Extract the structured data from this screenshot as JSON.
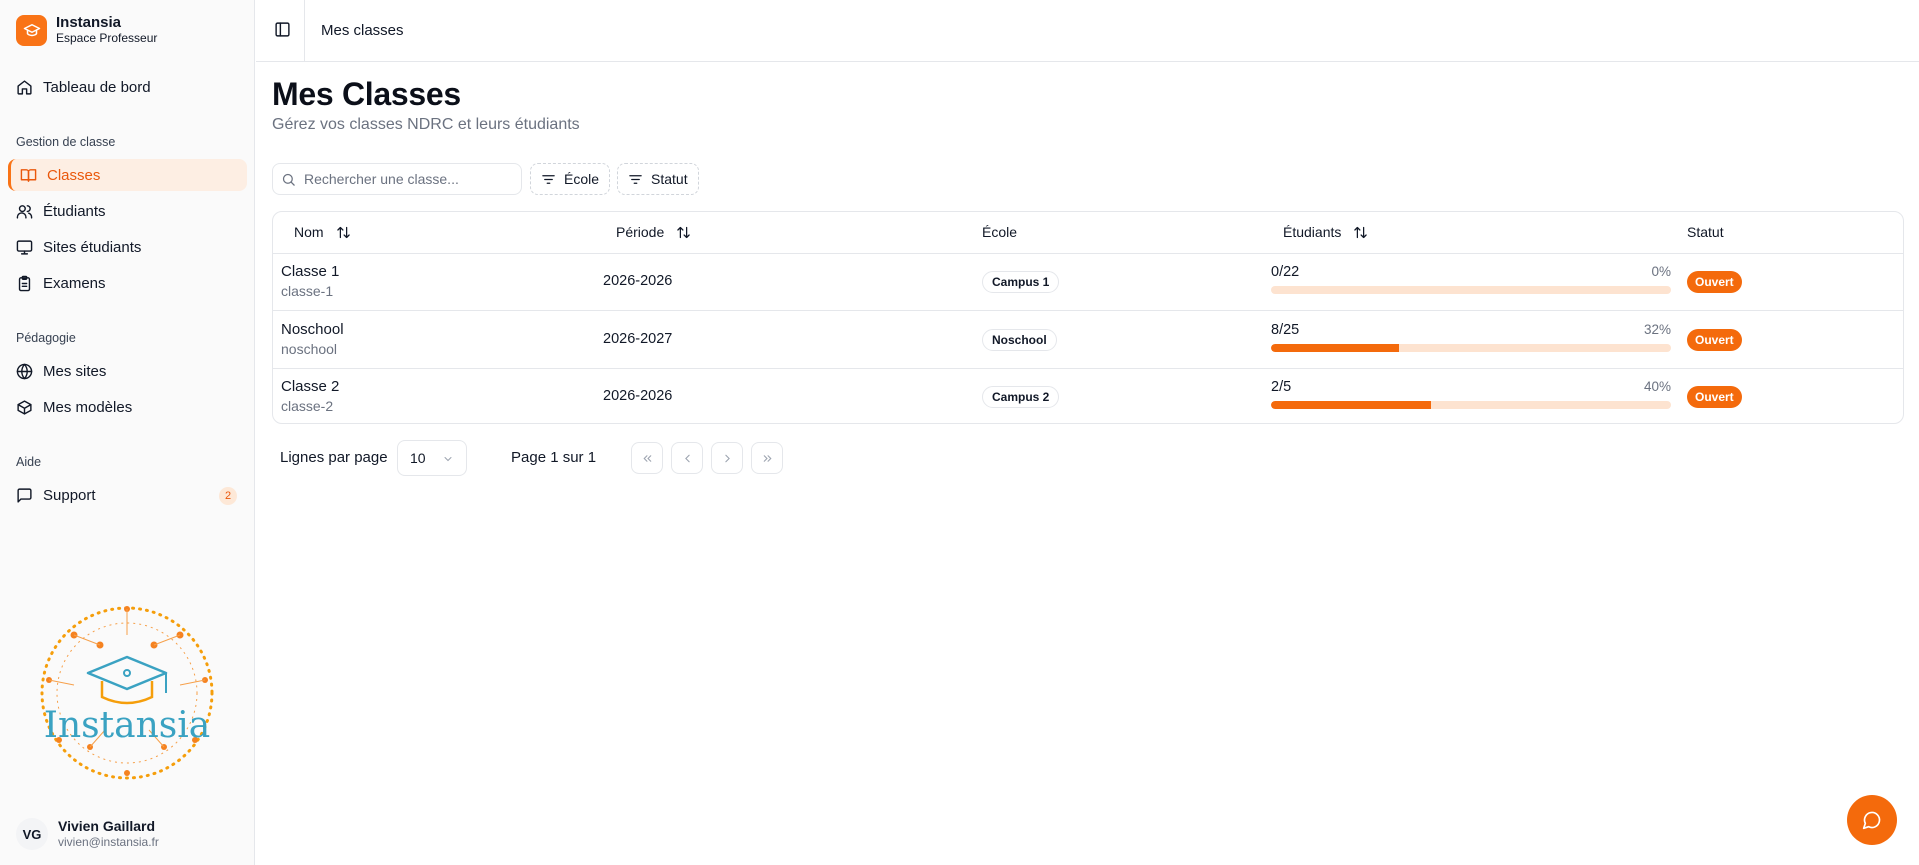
{
  "brand": {
    "name": "Instansia",
    "subtitle": "Espace Professeur"
  },
  "sidebar": {
    "dashboard": "Tableau de bord",
    "sections": {
      "class_mgmt": "Gestion de classe",
      "pedagogy": "Pédagogie",
      "help": "Aide"
    },
    "items": {
      "classes": "Classes",
      "students": "Étudiants",
      "student_sites": "Sites étudiants",
      "exams": "Examens",
      "my_sites": "Mes sites",
      "my_templates": "Mes modèles",
      "support": "Support",
      "support_count": "2"
    },
    "logo_text": "Instansia"
  },
  "user": {
    "initials": "VG",
    "name": "Vivien Gaillard",
    "email": "vivien@instansia.fr"
  },
  "topbar": {
    "title": "Mes classes"
  },
  "page": {
    "title": "Mes Classes",
    "subtitle": "Gérez vos classes NDRC et leurs étudiants"
  },
  "filters": {
    "search_placeholder": "Rechercher une classe...",
    "school": "École",
    "status": "Statut"
  },
  "table": {
    "headers": {
      "name": "Nom",
      "period": "Période",
      "school": "École",
      "students": "Étudiants",
      "status": "Statut"
    },
    "rows": [
      {
        "name": "Classe 1",
        "slug": "classe-1",
        "period": "2026-2026",
        "school": "Campus 1",
        "students": "0/22",
        "percent": "0%",
        "fill": 0.0,
        "status": "Ouvert"
      },
      {
        "name": "Noschool",
        "slug": "noschool",
        "period": "2026-2027",
        "school": "Noschool",
        "students": "8/25",
        "percent": "32%",
        "fill": 0.32,
        "status": "Ouvert"
      },
      {
        "name": "Classe 2",
        "slug": "classe-2",
        "period": "2026-2026",
        "school": "Campus 2",
        "students": "2/5",
        "percent": "40%",
        "fill": 0.4,
        "status": "Ouvert"
      }
    ]
  },
  "pagination": {
    "rows_label": "Lignes par page",
    "rows_value": "10",
    "page_label": "Page 1 sur 1"
  },
  "colors": {
    "accent": "#f46a0c",
    "accent_light": "#fde3d0",
    "active_bg": "#fdeee3"
  }
}
